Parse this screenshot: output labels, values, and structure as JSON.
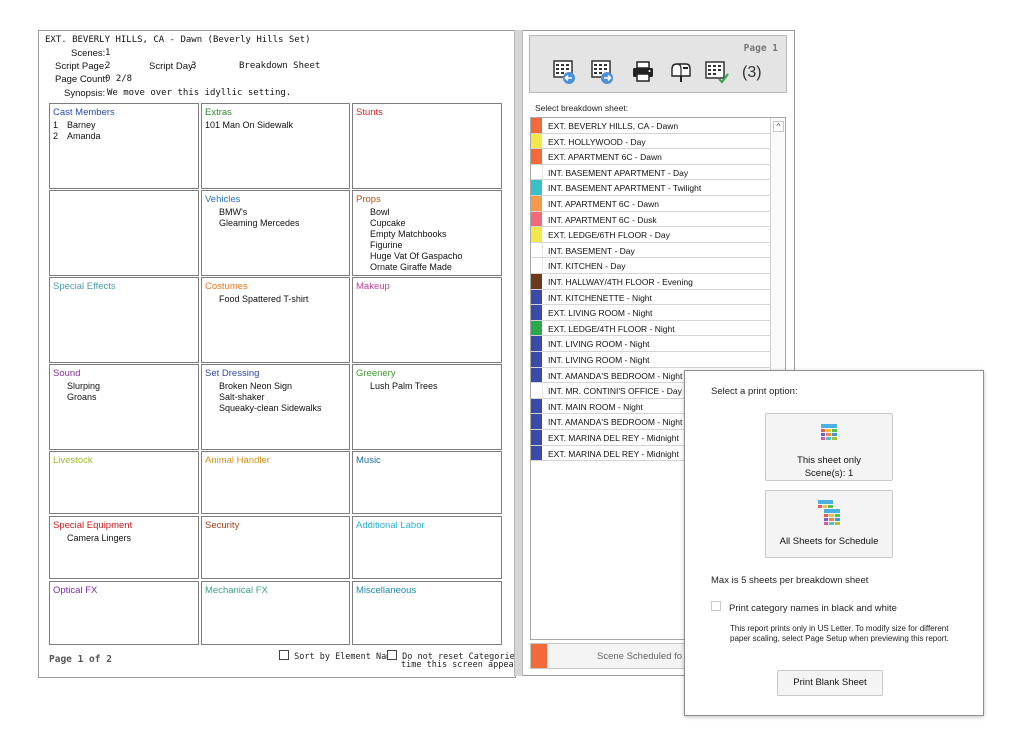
{
  "sheet": {
    "location": "EXT. BEVERLY HILLS, CA  - Dawn (Beverly Hills Set)",
    "scenes_label": "Scenes:",
    "scenes_value": "1",
    "script_page_label": "Script Page:",
    "script_page_value": "2",
    "script_day_label": "Script Day:",
    "script_day_value": "3",
    "sheet_title": "Breakdown Sheet",
    "page_count_label": "Page Count:",
    "page_count_value": "0  2/8",
    "synopsis_label": "Synopsis:",
    "synopsis_value": "We move over this idyllic setting.",
    "categories": {
      "cast": {
        "title": "Cast Members",
        "color": "#2a4aa8",
        "items": [
          {
            "num": "1",
            "name": "Barney"
          },
          {
            "num": "2",
            "name": "Amanda"
          }
        ]
      },
      "extras": {
        "title": "Extras",
        "color": "#2e8a2e",
        "items": [
          "101 Man On Sidewalk"
        ]
      },
      "stunts": {
        "title": "Stunts",
        "color": "#d42a2a",
        "items": []
      },
      "vehicles": {
        "title": "Vehicles",
        "color": "#2a6fbf",
        "items": [
          "BMW's",
          "Gleaming Mercedes"
        ]
      },
      "props": {
        "title": "Props",
        "color": "#b0541c",
        "items": [
          "Bowl",
          "Cupcake",
          "Empty Matchbooks",
          "Figurine",
          "Huge Vat Of Gaspacho",
          "Ornate Giraffe Made"
        ]
      },
      "special_effects": {
        "title": "Special Effects",
        "color": "#4a9aa8",
        "items": []
      },
      "costumes": {
        "title": "Costumes",
        "color": "#e8761e",
        "items": [
          "Food Spattered T-shirt"
        ]
      },
      "makeup": {
        "title": "Makeup",
        "color": "#c0409a",
        "items": []
      },
      "sound": {
        "title": "Sound",
        "color": "#8a2aa0",
        "items": [
          "Slurping",
          "Groans"
        ]
      },
      "set_dressing": {
        "title": "Set Dressing",
        "color": "#2a4aa8",
        "items": [
          "Broken Neon Sign",
          "Salt-shaker",
          "Squeaky-clean Sidewalks"
        ]
      },
      "greenery": {
        "title": "Greenery",
        "color": "#3a9a2a",
        "items": [
          "Lush Palm Trees"
        ]
      },
      "livestock": {
        "title": "Livestock",
        "color": "#9ab82a",
        "items": []
      },
      "animal_handler": {
        "title": "Animal Handler",
        "color": "#d8901a",
        "items": []
      },
      "music": {
        "title": "Music",
        "color": "#1a6aa8",
        "items": []
      },
      "special_equipment": {
        "title": "Special Equipment",
        "color": "#c81a1a",
        "items": [
          "Camera Lingers"
        ]
      },
      "security": {
        "title": "Security",
        "color": "#a8401a",
        "items": []
      },
      "additional_labor": {
        "title": "Additional Labor",
        "color": "#2ab0d0",
        "items": []
      },
      "optical_fx": {
        "title": "Optical FX",
        "color": "#7a2aa8",
        "items": []
      },
      "mechanical_fx": {
        "title": "Mechanical FX",
        "color": "#3aa08a",
        "items": []
      },
      "miscellaneous": {
        "title": "Miscellaneous",
        "color": "#1a8ab0",
        "items": []
      }
    },
    "footer": {
      "page_label": "Page 1 of 2",
      "sort_label": "Sort by Element Name",
      "reset_label_1": "Do not reset Categories every",
      "reset_label_2": "time this screen appears."
    }
  },
  "panel": {
    "page_label": "Page 1",
    "count_label": "(3)",
    "icons": [
      "previous-sheet-icon",
      "next-sheet-icon",
      "printer-icon",
      "mailbox-icon",
      "sheet-check-icon"
    ],
    "select_label": "Select breakdown sheet:",
    "sheets": [
      {
        "label": "EXT. BEVERLY HILLS, CA  - Dawn",
        "color": "#f26a3a"
      },
      {
        "label": "EXT. HOLLYWOOD  - Day",
        "color": "#f2e84a"
      },
      {
        "label": "EXT. APARTMENT 6C  - Dawn",
        "color": "#f26a3a"
      },
      {
        "label": "INT. BASEMENT APARTMENT  - Day",
        "color": "#ffffff"
      },
      {
        "label": "INT. BASEMENT APARTMENT  - Twilight",
        "color": "#3ac0c8"
      },
      {
        "label": "INT. APARTMENT 6C  - Dawn",
        "color": "#f59a4a"
      },
      {
        "label": "INT. APARTMENT 6C  - Dusk",
        "color": "#f06a7a"
      },
      {
        "label": "EXT. LEDGE/6TH FLOOR  - Day",
        "color": "#f2e84a"
      },
      {
        "label": "INT. BASEMENT  - Day",
        "color": "#ffffff"
      },
      {
        "label": "INT. KITCHEN  - Day",
        "color": "#ffffff"
      },
      {
        "label": "INT. HALLWAY/4TH FLOOR  - Evening",
        "color": "#6a3a1a"
      },
      {
        "label": "INT. KITCHENETTE  - Night",
        "color": "#3a4aa8"
      },
      {
        "label": "EXT. LIVING ROOM  - Night",
        "color": "#3a4aa8"
      },
      {
        "label": "EXT. LEDGE/4TH FLOOR  - Night",
        "color": "#2aa84a"
      },
      {
        "label": "INT. LIVING ROOM  - Night",
        "color": "#3a4aa8"
      },
      {
        "label": "INT. LIVING ROOM  - Night",
        "color": "#3a4aa8"
      },
      {
        "label": "INT. AMANDA'S BEDROOM  - Night",
        "color": "#3a4aa8"
      },
      {
        "label": "INT. MR. CONTINI'S OFFICE - Day",
        "color": "#ffffff"
      },
      {
        "label": "INT. MAIN ROOM  - Night",
        "color": "#3a4aa8"
      },
      {
        "label": "INT. AMANDA'S BEDROOM  - Night",
        "color": "#3a4aa8"
      },
      {
        "label": "EXT. MARINA DEL REY - Midnight",
        "color": "#3a4aa8"
      },
      {
        "label": "EXT. MARINA DEL REY - Midnight",
        "color": "#3a4aa8"
      }
    ],
    "scheduled_label": "Scene Scheduled fo"
  },
  "popup": {
    "title": "Select a print option:",
    "this_sheet_line1": "This sheet only",
    "this_sheet_line2": "Scene(s): 1",
    "all_sheets_label": "All Sheets for Schedule",
    "max_label": "Max is 5 sheets per breakdown sheet",
    "bw_label": "Print category names in black and white",
    "note": "This report prints only in US Letter. To modify size for different paper scaling, select Page Setup when previewing this report.",
    "blank_button": "Print Blank Sheet"
  }
}
